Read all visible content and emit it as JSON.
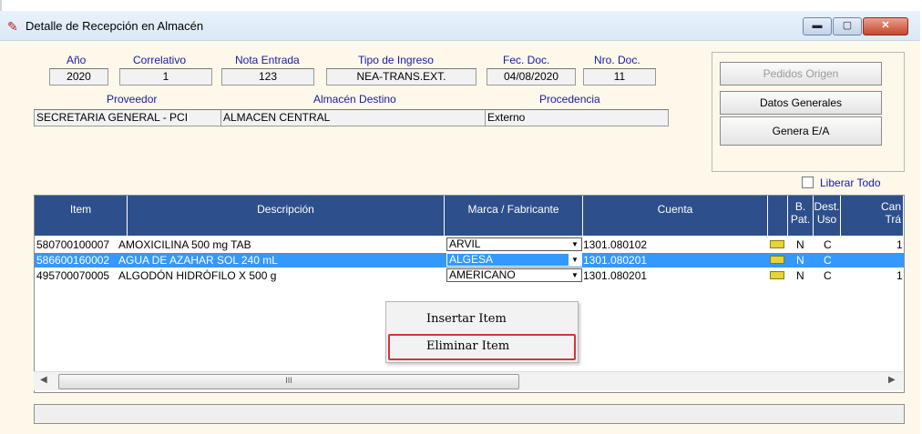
{
  "window": {
    "title": "Detalle de Recepción en Almacén",
    "minimize_label": "▬",
    "maximize_label": "▢",
    "close_label": "✕"
  },
  "fields": {
    "anio": {
      "label": "Año",
      "value": "2020"
    },
    "correlativo": {
      "label": "Correlativo",
      "value": "1"
    },
    "nota_entrada": {
      "label": "Nota Entrada",
      "value": "123"
    },
    "tipo_ingreso": {
      "label": "Tipo de Ingreso",
      "value": "NEA-TRANS.EXT."
    },
    "fec_doc": {
      "label": "Fec. Doc.",
      "value": "04/08/2020"
    },
    "nro_doc": {
      "label": "Nro. Doc.",
      "value": "11"
    },
    "proveedor": {
      "label": "Proveedor",
      "value": "SECRETARIA GENERAL - PCI"
    },
    "almacen_destino": {
      "label": "Almacén Destino",
      "value": "ALMACEN CENTRAL"
    },
    "procedencia": {
      "label": "Procedencia",
      "value": "Externo"
    }
  },
  "buttons": {
    "pedidos_origen": "Pedidos Origen",
    "datos_generales": "Datos Generales",
    "genera_ea": "Genera E/A"
  },
  "liberar_todo": {
    "label": "Liberar Todo",
    "checked": false
  },
  "grid": {
    "columns": {
      "item": "Item",
      "descripcion": "Descripción",
      "marca": "Marca / Fabricante",
      "cuenta": "Cuenta",
      "bpat_1": "B.",
      "bpat_2": "Pat.",
      "dest_1": "Dest.",
      "dest_2": "Uso",
      "can_1": "Can",
      "can_2": "Trá"
    },
    "rows": [
      {
        "item": "580700100007",
        "descripcion": "AMOXICILINA 500 mg TAB",
        "marca": "ARVIL",
        "cuenta": "1301.080102",
        "bpat": "N",
        "dest": "C",
        "can": "1",
        "selected": false
      },
      {
        "item": "586600160002",
        "descripcion": "AGUA DE AZAHAR SOL 240 mL",
        "marca": "ALGESA",
        "cuenta": "1301.080201",
        "bpat": "N",
        "dest": "C",
        "can": "",
        "selected": true
      },
      {
        "item": "495700070005",
        "descripcion": "ALGODÓN HIDRÓFILO X 500 g",
        "marca": "AMERICANO",
        "cuenta": "1301.080201",
        "bpat": "N",
        "dest": "C",
        "can": "1",
        "selected": false
      }
    ]
  },
  "context_menu": {
    "insert": "Insertar Item",
    "delete": "Eliminar Item"
  },
  "scroll": {
    "grip": "III"
  },
  "colors": {
    "header_bg": "#2d4f8c",
    "selection": "#3399ff",
    "highlight_border": "#d9333a"
  }
}
